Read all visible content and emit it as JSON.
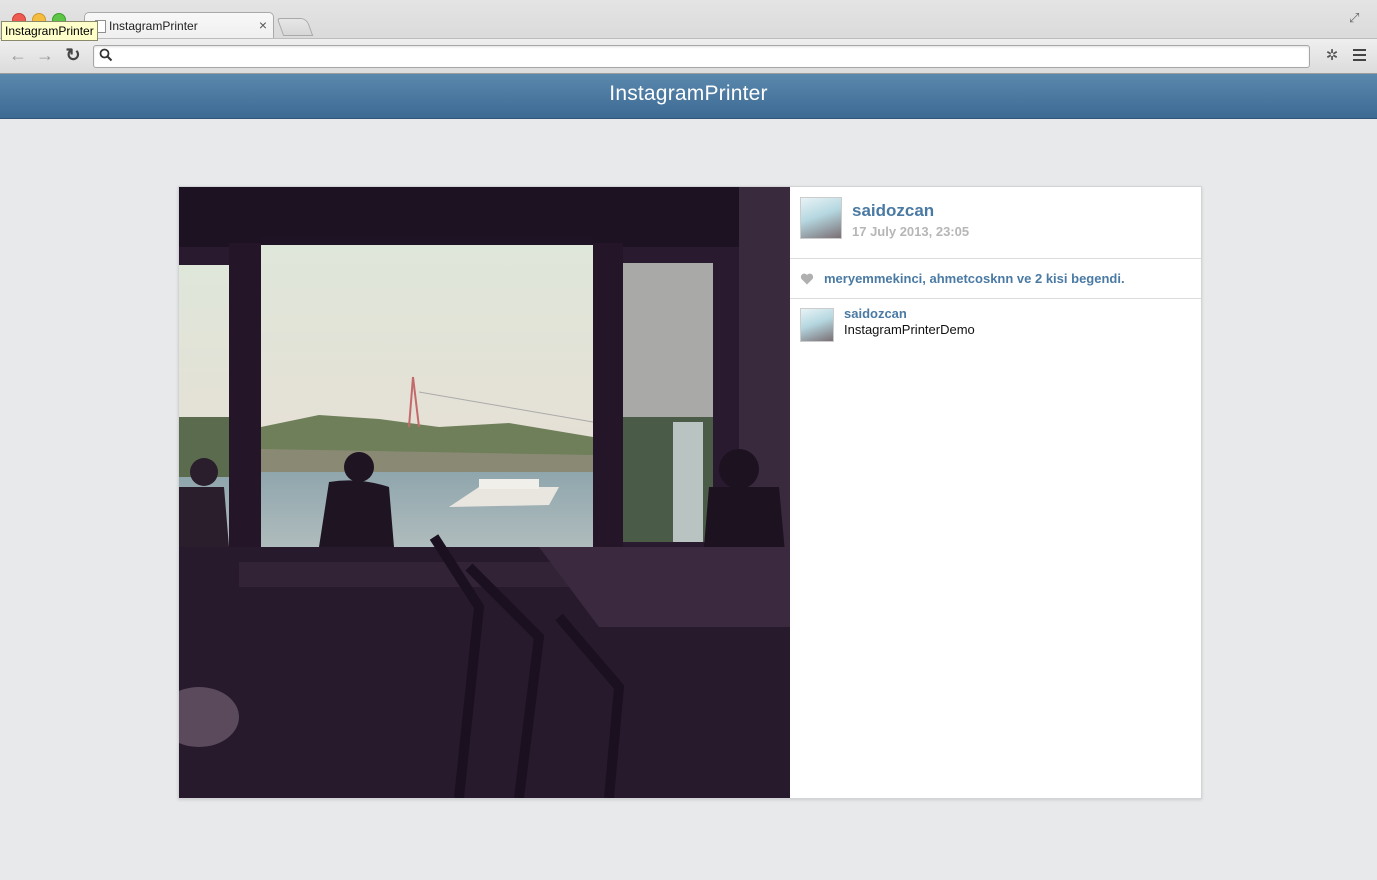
{
  "browser": {
    "tab_title": "InstagramPrinter",
    "tooltip": "InstagramPrinter",
    "url": ""
  },
  "app": {
    "title": "InstagramPrinter"
  },
  "post": {
    "username": "saidozcan",
    "date": "17 July 2013, 23:05",
    "likes_text": "meryemmekinci, ahmetcosknn ve 2 kisi begendi.",
    "comments": [
      {
        "username": "saidozcan",
        "text": "InstagramPrinterDemo"
      }
    ]
  },
  "icons": {
    "back": "arrow-left-icon",
    "forward": "arrow-right-icon",
    "reload": "reload-icon",
    "search": "search-icon",
    "menu": "menu-icon",
    "extension": "extension-bug-icon",
    "like": "heart-icon"
  },
  "colors": {
    "header": "#4a7aa3",
    "link": "#4a7aa3",
    "background": "#e8e9eb"
  }
}
